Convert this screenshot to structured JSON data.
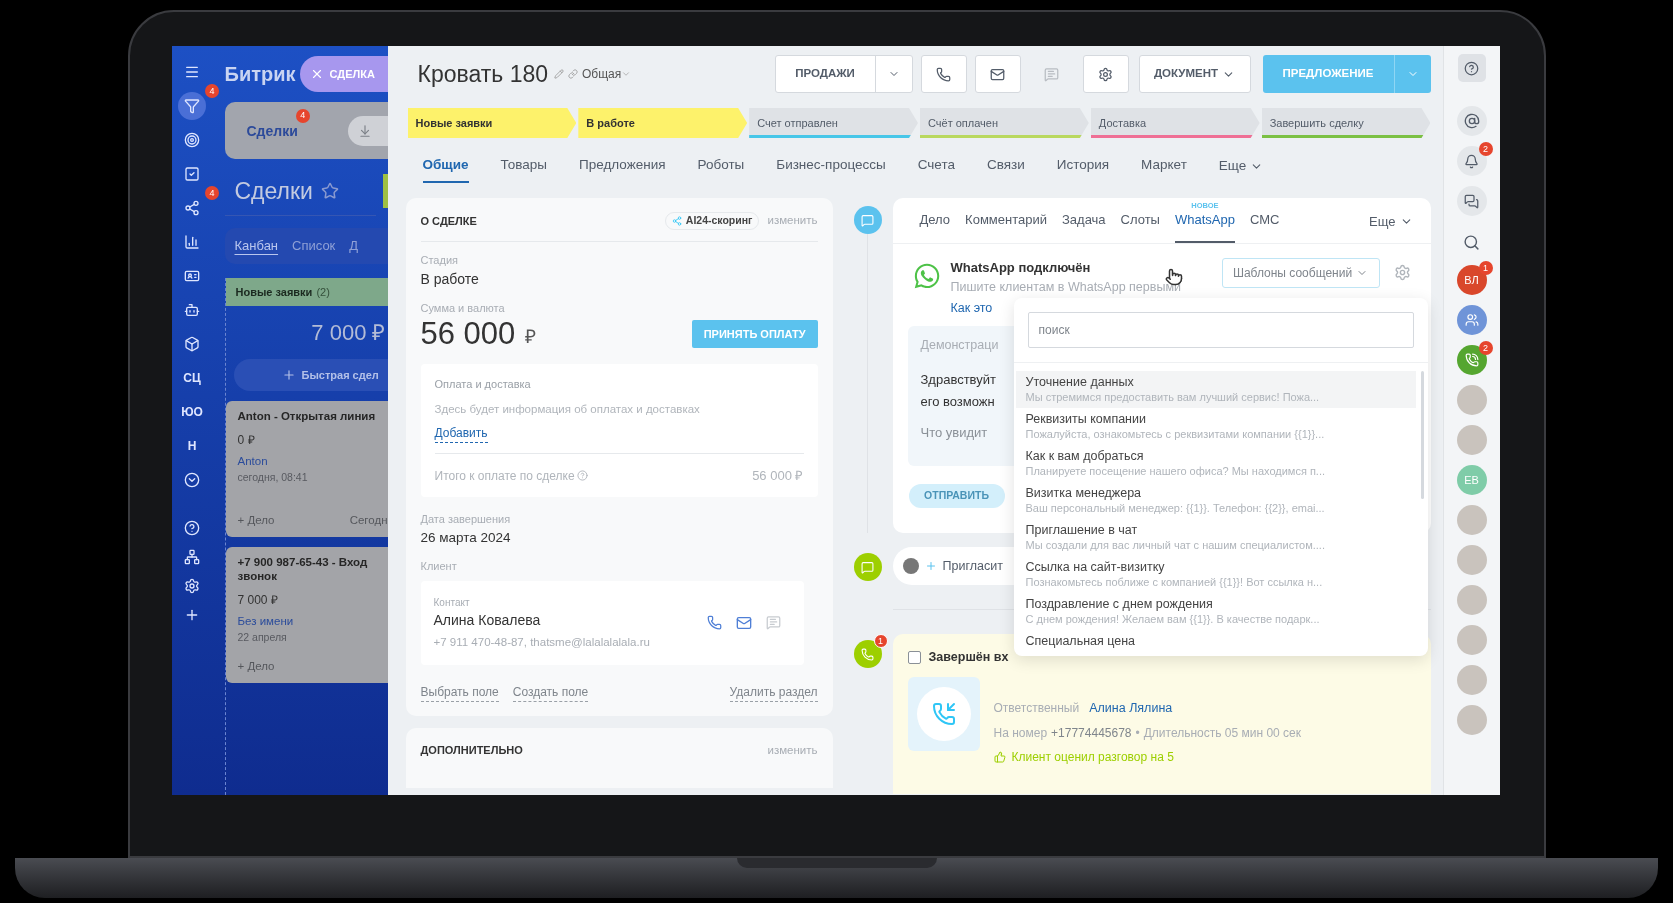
{
  "left_rail": {
    "top": [
      {
        "kind": "icon",
        "selected": false
      },
      {
        "kind": "icon",
        "selected": true,
        "badge": "4"
      },
      {
        "kind": "icon",
        "selected": false
      },
      {
        "kind": "icon",
        "selected": false
      },
      {
        "kind": "icon",
        "selected": false,
        "badge": "4"
      },
      {
        "kind": "icon",
        "selected": false
      },
      {
        "kind": "icon",
        "selected": false
      },
      {
        "kind": "icon",
        "selected": false
      },
      {
        "kind": "icon",
        "selected": false
      },
      {
        "kind": "text",
        "label": "СЦ",
        "selected": false
      },
      {
        "kind": "text",
        "label": "ЮО",
        "selected": false
      },
      {
        "kind": "text",
        "label": "Н",
        "selected": false
      },
      {
        "kind": "icon",
        "selected": false
      }
    ]
  },
  "kanban": {
    "logo": "Битрик",
    "close_tab": "СДЕЛКА",
    "tab": {
      "label": "Сделки",
      "badge": "4"
    },
    "title": "Сделки",
    "views": [
      {
        "label": "Канбан",
        "selected": true
      },
      {
        "label": "Список",
        "selected": false
      },
      {
        "label": "Д",
        "selected": false
      }
    ],
    "column": {
      "title": "Новые заявки",
      "count": "(2)",
      "total": "7 000 ₽",
      "quick_add": "Быстрая сдел"
    },
    "cards": [
      {
        "title_lines": [
          "Anton - Открытая линия"
        ],
        "amount": "0 ₽",
        "client": "Anton",
        "date": "сегодня, 08:41",
        "action": "+ Дело",
        "deadline": "Сегодн"
      },
      {
        "title_lines": [
          "+7 900 987-65-43 - Вход",
          "звонок"
        ],
        "amount": "7 000 ₽",
        "client": "Без имени",
        "date": "22 апреля",
        "action": "+ Дело"
      }
    ]
  },
  "header": {
    "title": "Кровать 180",
    "category": "Общая"
  },
  "toolbar": {
    "sales": "ПРОДАЖИ",
    "icons": [
      {
        "disabled": false
      },
      {
        "disabled": false
      },
      {
        "disabled": true
      },
      {
        "disabled": false
      }
    ],
    "document": "ДОКУМЕНТ",
    "offer": "ПРЕДЛОЖЕНИЕ"
  },
  "stages": [
    {
      "label": "Новые заявки",
      "done": true,
      "color": "#fdf26b"
    },
    {
      "label": "В работе",
      "done": true,
      "color": "#fdf26b"
    },
    {
      "label": "Счет отправлен",
      "done": false,
      "color": "#47c6e8"
    },
    {
      "label": "Счёт оплачен",
      "done": false,
      "color": "#b9d85e"
    },
    {
      "label": "Доставка",
      "done": false,
      "color": "#ef6f95"
    },
    {
      "label": "Завершить сделку",
      "done": false,
      "color": "#7bc043"
    }
  ],
  "tabs": [
    {
      "label": "Общие",
      "selected": true
    },
    {
      "label": "Товары",
      "selected": false
    },
    {
      "label": "Предложения",
      "selected": false
    },
    {
      "label": "Роботы",
      "selected": false
    },
    {
      "label": "Бизнес-процессы",
      "selected": false
    },
    {
      "label": "Счета",
      "selected": false
    },
    {
      "label": "Связи",
      "selected": false
    },
    {
      "label": "История",
      "selected": false
    },
    {
      "label": "Маркет",
      "selected": false
    }
  ],
  "tabs_more": "Еще",
  "deal": {
    "heading": "О СДЕЛКЕ",
    "scoring": "AI24-скоринг",
    "edit": "изменить",
    "stage_label": "Стадия",
    "stage": "В работе",
    "amount_label": "Сумма и валюта",
    "amount": "56 000",
    "currency": "₽",
    "pay_button": "ПРИНЯТЬ ОПЛАТУ",
    "payment": {
      "title": "Оплата и доставка",
      "text": "Здесь будет информация об оплатах и доставках",
      "add": "Добавить",
      "total_label": "Итого к оплате по сделке",
      "total": "56 000 ₽"
    },
    "date_label": "Дата завершения",
    "date": "26 марта 2024",
    "client_label": "Клиент",
    "contact": {
      "label": "Контакт",
      "name": "Алина Ковалева",
      "details": "+7 911 470-48-87, thatsme@lalalalalala.ru"
    },
    "links": [
      "Выбрать поле",
      "Создать поле"
    ],
    "delete": "Удалить раздел"
  },
  "extra": {
    "heading": "ДОПОЛНИТЕЛЬНО",
    "edit": "изменить"
  },
  "activity": {
    "tabs": [
      {
        "label": "Дело",
        "selected": false
      },
      {
        "label": "Комментарий",
        "selected": false
      },
      {
        "label": "Задача",
        "selected": false
      },
      {
        "label": "Слоты",
        "selected": false
      },
      {
        "label": "WhatsApp",
        "selected": true,
        "tag": "НОВОЕ"
      },
      {
        "label": "СМС",
        "selected": false
      }
    ],
    "more": "Еще",
    "whatsapp": {
      "title": "WhatsApp подключён",
      "subtitle": "Пишите клиентам в WhatsApp первыми",
      "link": "Как это",
      "templates_button": "Шаблоны сообщений",
      "demo_heading": "Демонстраци",
      "demo_lines": [
        "Здравствуйт",
        "его возможн"
      ],
      "demo_hint": "Что увидит",
      "send": "ОТПРАВИТЬ",
      "send_disabled": true
    }
  },
  "templates": {
    "placeholder": "поиск",
    "items": [
      {
        "title": "Уточнение данных",
        "preview": "Мы стремимся предоставить вам лучший сервис! Пожа...",
        "selected": true
      },
      {
        "title": "Реквизиты компании",
        "preview": "Пожалуйста, ознакомьтесь с реквизитами компании {{1}}...",
        "selected": false
      },
      {
        "title": "Как к вам добраться",
        "preview": "Планируете посещение нашего офиса? Мы находимся п...",
        "selected": false
      },
      {
        "title": "Визитка менеджера",
        "preview": "Ваш персональный менеджер: {{1}}. Телефон: {{2}}, emai...",
        "selected": false
      },
      {
        "title": "Приглашение в чат",
        "preview": "Мы создали для вас личный чат с нашим специалистом....",
        "selected": false
      },
      {
        "title": "Ссылка на сайт-визитку",
        "preview": "Познакомьтесь поближе с компанией {{1}}! Вот ссылка н...",
        "selected": false
      },
      {
        "title": "Поздравление с днем рождения",
        "preview": "С днем рождения! Желаем вам {{1}}. В качестве подарк...",
        "selected": false
      },
      {
        "title": "Специальная цена",
        "selected": false
      }
    ]
  },
  "timeline": {
    "invite": "Пригласит",
    "call": {
      "badge": "1",
      "checked": false,
      "title": "Завершён вх",
      "responsible_label": "Ответственный",
      "responsible": "Алина Лялина",
      "number_label": "На номер",
      "number": "+17774445678",
      "separator": "•",
      "duration": "Длительность 05 мин 00 сек",
      "rating": "Клиент оценил разговор на 5"
    }
  },
  "right_rail": [
    {
      "kind": "help"
    },
    {
      "kind": "assistant"
    },
    {
      "kind": "bell",
      "badge": "2"
    },
    {
      "kind": "chats"
    },
    {
      "kind": "search"
    },
    {
      "kind": "initials",
      "label": "ВЛ",
      "color": "#d9472b",
      "badge": "1"
    },
    {
      "kind": "group"
    },
    {
      "kind": "call",
      "badge": "2"
    },
    {
      "kind": "photo"
    },
    {
      "kind": "photo"
    },
    {
      "kind": "initials",
      "label": "ЕВ",
      "color": "#7fcca8"
    },
    {
      "kind": "photo"
    },
    {
      "kind": "photo"
    },
    {
      "kind": "photo"
    },
    {
      "kind": "photo"
    },
    {
      "kind": "photo"
    },
    {
      "kind": "photo"
    }
  ]
}
